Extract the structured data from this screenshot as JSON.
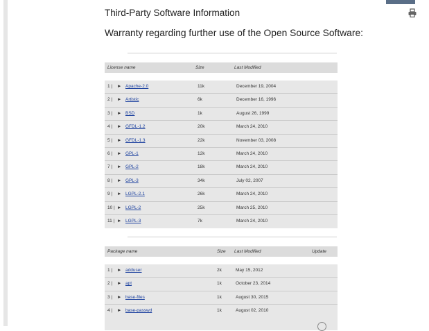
{
  "page": {
    "title": "Third-Party Software Information",
    "subtitle": "Warranty regarding further use of the Open Source Software:",
    "print_icon": "printer-icon",
    "arrow_glyph": "►"
  },
  "licenses": {
    "headers": {
      "name": "License name",
      "size": "Size",
      "modified": "Last Modified"
    },
    "rows": [
      {
        "num": "1 |",
        "name": "Apache-2.0",
        "size": "11k",
        "modified": "December 19, 2004"
      },
      {
        "num": "2 |",
        "name": "Artistic",
        "size": "6k",
        "modified": "December 16, 1996"
      },
      {
        "num": "3 |",
        "name": "BSD",
        "size": "1k",
        "modified": "August 26, 1999"
      },
      {
        "num": "4 |",
        "name": "GFDL-1.2",
        "size": "20k",
        "modified": "March 24, 2010"
      },
      {
        "num": "5 |",
        "name": "GFDL-1.3",
        "size": "22k",
        "modified": "November 03, 2008"
      },
      {
        "num": "6 |",
        "name": "GPL-1",
        "size": "12k",
        "modified": "March 24, 2010"
      },
      {
        "num": "7 |",
        "name": "GPL-2",
        "size": "18k",
        "modified": "March 24, 2010"
      },
      {
        "num": "8 |",
        "name": "GPL-3",
        "size": "34k",
        "modified": "July 02, 2007"
      },
      {
        "num": "9 |",
        "name": "LGPL-2.1",
        "size": "26k",
        "modified": "March 24, 2010"
      },
      {
        "num": "10 |",
        "name": "LGPL-2",
        "size": "25k",
        "modified": "March 25, 2010"
      },
      {
        "num": "11 |",
        "name": "LGPL-3",
        "size": "7k",
        "modified": "March 24, 2010"
      }
    ]
  },
  "packages": {
    "headers": {
      "name": "Package name",
      "size": "Size",
      "modified": "Last Modified",
      "update": "Update"
    },
    "rows": [
      {
        "num": "1 |",
        "name": "adduser",
        "size": "2k",
        "modified": "May 15, 2012"
      },
      {
        "num": "2 |",
        "name": "apt",
        "size": "1k",
        "modified": "October 23, 2014"
      },
      {
        "num": "3 |",
        "name": "base-files",
        "size": "1k",
        "modified": "August 30, 2015"
      },
      {
        "num": "4 |",
        "name": "base-passwd",
        "size": "1k",
        "modified": "August 02, 2010"
      }
    ]
  }
}
